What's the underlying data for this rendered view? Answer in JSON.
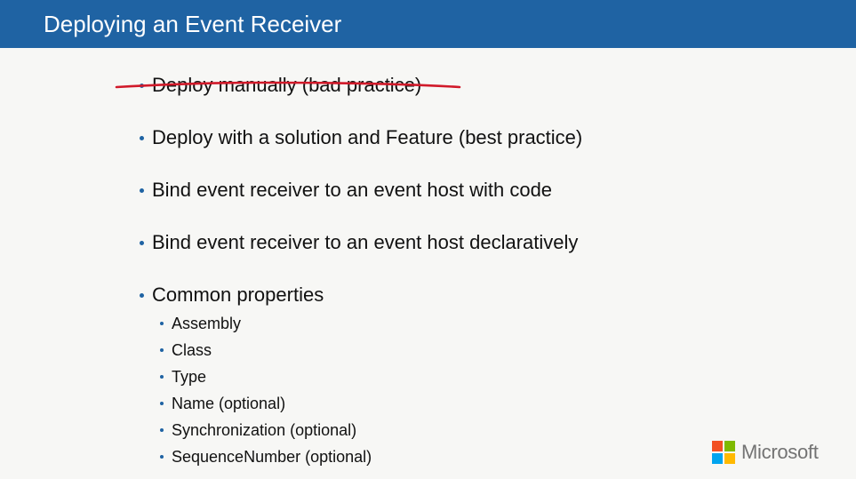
{
  "slide": {
    "title": "Deploying an Event Receiver"
  },
  "bullets": [
    {
      "text": "Deploy manually (bad practice)",
      "struck_through": true
    },
    {
      "text": "Deploy with a solution and Feature (best practice)"
    },
    {
      "text": "Bind event receiver to an event host with code"
    },
    {
      "text": "Bind event receiver to an event host declaratively"
    },
    {
      "text": "Common properties"
    }
  ],
  "sub_bullets": [
    {
      "text": "Assembly"
    },
    {
      "text": "Class"
    },
    {
      "text": "Type"
    },
    {
      "text": "Name (optional)"
    },
    {
      "text": "Synchronization (optional)"
    },
    {
      "text": "SequenceNumber (optional)"
    }
  ],
  "logo": {
    "text": "Microsoft",
    "colors": [
      "#f25022",
      "#7fba00",
      "#00a4ef",
      "#ffb900"
    ]
  },
  "colors": {
    "title_bar": "#1f63a3",
    "bullet": "#1f63a3",
    "annotation_ink": "#d11a2a"
  }
}
